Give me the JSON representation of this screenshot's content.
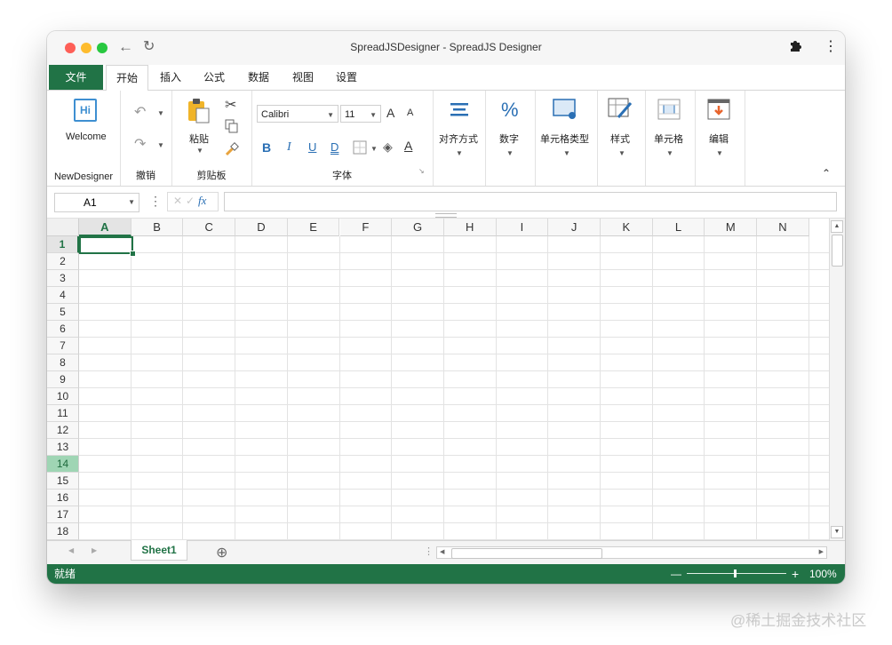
{
  "window": {
    "title": "SpreadJSDesigner - SpreadJS Designer"
  },
  "ribbon_tabs": [
    {
      "label": "文件"
    },
    {
      "label": "开始"
    },
    {
      "label": "插入"
    },
    {
      "label": "公式"
    },
    {
      "label": "数据"
    },
    {
      "label": "视图"
    },
    {
      "label": "设置"
    }
  ],
  "ribbon": {
    "newdesigner": {
      "button": "Welcome",
      "icon_text": "Hi",
      "group": "NewDesigner"
    },
    "undo_group": {
      "group": "撤销"
    },
    "clipboard": {
      "paste": "粘贴",
      "group": "剪贴板"
    },
    "font": {
      "family": "Calibri",
      "size": "11",
      "bold": "B",
      "italic": "I",
      "underline": "U",
      "double_underline": "D",
      "color_glyph": "A",
      "grow": "A",
      "shrink": "A",
      "group": "字体"
    },
    "align": {
      "label": "对齐方式"
    },
    "number": {
      "label": "数字",
      "glyph": "%"
    },
    "cell_type": {
      "label": "单元格类型"
    },
    "style": {
      "label": "样式"
    },
    "cells": {
      "label": "单元格"
    },
    "edit": {
      "label": "编辑"
    }
  },
  "formula_bar": {
    "name_box": "A1",
    "fx": "fx",
    "formula": ""
  },
  "grid": {
    "columns": [
      "A",
      "B",
      "C",
      "D",
      "E",
      "F",
      "G",
      "H",
      "I",
      "J",
      "K",
      "L",
      "M",
      "N"
    ],
    "rows": [
      "1",
      "2",
      "3",
      "4",
      "5",
      "6",
      "7",
      "8",
      "9",
      "10",
      "11",
      "12",
      "13",
      "14",
      "15",
      "16",
      "17",
      "18"
    ],
    "selected_column": "A",
    "selected_row": "1",
    "highlighted_row": "14"
  },
  "sheets": [
    {
      "name": "Sheet1"
    }
  ],
  "status": {
    "text": "就绪",
    "zoom": "100%",
    "minus": "—",
    "plus": "+"
  },
  "watermark": "@稀土掘金技术社区"
}
